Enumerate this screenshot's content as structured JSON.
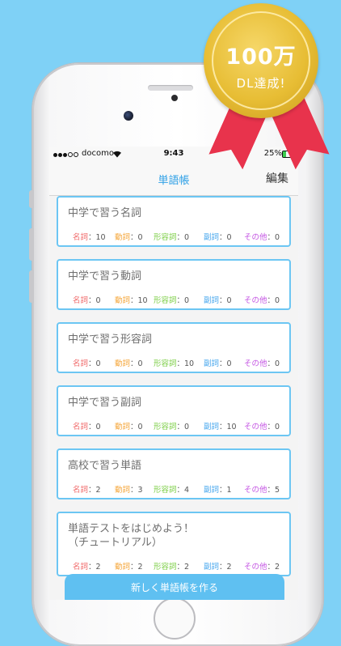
{
  "badge": {
    "line1": "100万",
    "line2": "DL達成!"
  },
  "status_bar": {
    "carrier": "docomo",
    "time": "9:43",
    "battery": "25%"
  },
  "nav": {
    "title": "単語帳",
    "edit": "編集"
  },
  "labels": {
    "noun": "名詞",
    "verb": "動詞",
    "adjective": "形容詞",
    "adverb": "副詞",
    "other": "その他"
  },
  "wordbooks": [
    {
      "title": "中学で習う名詞",
      "noun": "：10",
      "verb": "：0",
      "adjective": "：0",
      "adverb": "：0",
      "other": "：0"
    },
    {
      "title": "中学で習う動詞",
      "noun": "：0",
      "verb": "：10",
      "adjective": "：0",
      "adverb": "：0",
      "other": "：0"
    },
    {
      "title": "中学で習う形容詞",
      "noun": "：0",
      "verb": "：0",
      "adjective": "：10",
      "adverb": "：0",
      "other": "：0"
    },
    {
      "title": "中学で習う副詞",
      "noun": "：0",
      "verb": "：0",
      "adjective": "：0",
      "adverb": "：10",
      "other": "：0"
    },
    {
      "title": "高校で習う単語",
      "noun": "：2",
      "verb": "：3",
      "adjective": "：4",
      "adverb": "：1",
      "other": "：5"
    },
    {
      "title": "単語テストをはじめよう！\n（チュートリアル）",
      "noun": "：2",
      "verb": "：2",
      "adjective": "：2",
      "adverb": "：2",
      "other": "：2"
    }
  ],
  "create_button": "新しく単語帳を作る"
}
